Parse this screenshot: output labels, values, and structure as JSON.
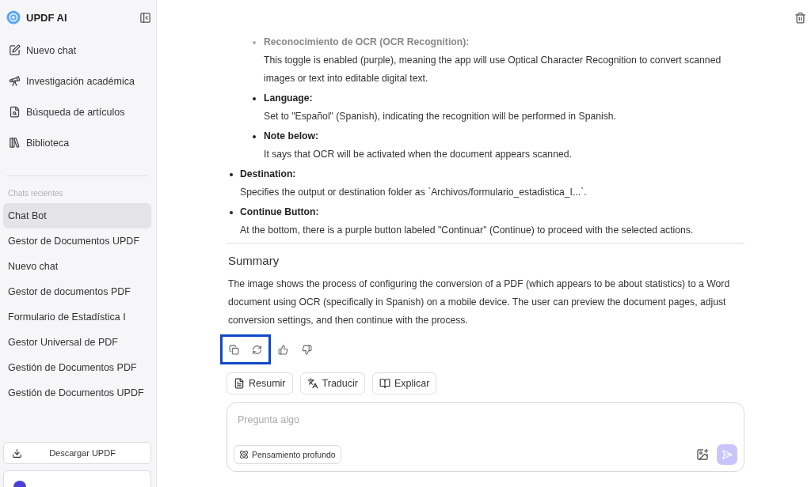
{
  "sidebar": {
    "brand": "UPDF AI",
    "nav": [
      {
        "kind": "new",
        "label": "Nuevo chat"
      },
      {
        "kind": "research",
        "label": "Investigación académica"
      },
      {
        "kind": "search",
        "label": "Búsqueda de artículos"
      },
      {
        "kind": "library",
        "label": "Biblioteca"
      }
    ],
    "recent_label": "Chats recientes",
    "recent": [
      {
        "label": "Chat Bot",
        "selected": true
      },
      {
        "label": "Gestor de Documentos UPDF",
        "selected": false
      },
      {
        "label": "Nuevo chat",
        "selected": false
      },
      {
        "label": "Gestor de documentos PDF",
        "selected": false
      },
      {
        "label": "Formulario de Estadística I",
        "selected": false
      },
      {
        "label": "Gestor Universal de PDF",
        "selected": false
      },
      {
        "label": "Gestión de Documentos PDF",
        "selected": false
      },
      {
        "label": "Gestión de Documentos UPDF",
        "selected": false
      }
    ],
    "download_button": "Descargar UPDF"
  },
  "message": {
    "nested_points": [
      {
        "title": "Reconocimiento de OCR (OCR Recognition):",
        "faded": true,
        "text": "This toggle is enabled (purple), meaning the app will use Optical Character Recognition to convert scanned images or text into editable digital text."
      },
      {
        "title": "Language:",
        "faded": false,
        "text": "Set to \"Español\" (Spanish), indicating the recognition will be performed in Spanish."
      },
      {
        "title": "Note below:",
        "faded": false,
        "text": "It says that OCR will be activated when the document appears scanned."
      }
    ],
    "points": [
      {
        "title": "Destination:",
        "faded": false,
        "text": "Specifies the output or destination folder as `Archivos/formulario_estadistica_I...`."
      },
      {
        "title": "Continue Button:",
        "faded": false,
        "text": "At the bottom, there is a purple button labeled \"Continuar\" (Continue) to proceed with the selected actions."
      }
    ],
    "summary_heading": "Summary",
    "summary": "The image shows the process of configuring the conversion of a PDF (which appears to be about statistics) to a Word document using OCR (specifically in Spanish) on a mobile device. The user can preview the document pages, adjust conversion settings, and then continue with the process.",
    "actions": [
      {
        "kind": "copy",
        "highlighted": true
      },
      {
        "kind": "regenerate",
        "highlighted": true
      },
      {
        "kind": "like",
        "highlighted": false
      },
      {
        "kind": "dislike",
        "highlighted": false
      }
    ]
  },
  "quick_actions": [
    {
      "kind": "summarize",
      "label": "Resumir"
    },
    {
      "kind": "translate",
      "label": "Traducir"
    },
    {
      "kind": "explain",
      "label": "Explicar"
    }
  ],
  "composer": {
    "placeholder": "Pregunta algo",
    "deep_thinking": "Pensamiento profundo"
  }
}
